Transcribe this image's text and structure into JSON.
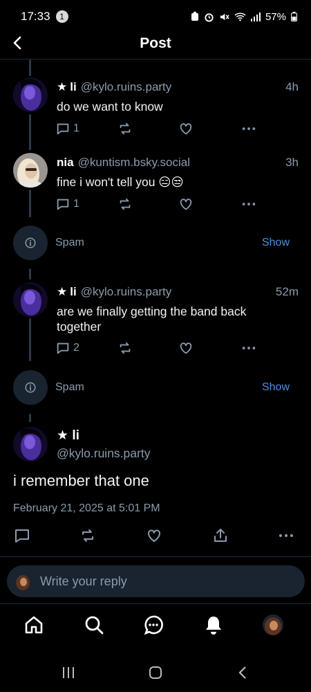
{
  "status_bar": {
    "time": "17:33",
    "notif_count": "1",
    "battery": "57%"
  },
  "header": {
    "title": "Post"
  },
  "posts": [
    {
      "star": "★",
      "name": "li",
      "handle": "@kylo.ruins.party",
      "time": "4h",
      "text": "do we want to know",
      "reply_count": "1"
    },
    {
      "name": "nia",
      "handle": "@kuntism.bsky.social",
      "time": "3h",
      "text": "fine i won't tell you 😑😒",
      "reply_count": "1"
    },
    {
      "star": "★",
      "name": "li",
      "handle": "@kylo.ruins.party",
      "time": "52m",
      "text": "are we finally getting the band back together",
      "reply_count": "2"
    }
  ],
  "spam": [
    {
      "label": "Spam",
      "action": "Show"
    },
    {
      "label": "Spam",
      "action": "Show"
    }
  ],
  "main_post": {
    "star": "★",
    "name": "li",
    "handle": "@kylo.ruins.party",
    "text": "i remember that one",
    "date": "February 21, 2025 at 5:01 PM"
  },
  "reply_box": {
    "placeholder": "Write your reply"
  },
  "colors": {
    "background": "#000000",
    "muted": "#8a9bad",
    "accent": "#4a90e2",
    "surface": "#1a2330"
  },
  "icons": [
    "back-icon",
    "reply-icon",
    "repost-icon",
    "like-icon",
    "more-icon",
    "share-icon",
    "info-icon",
    "home-icon",
    "search-icon",
    "chat-icon",
    "bell-icon"
  ]
}
